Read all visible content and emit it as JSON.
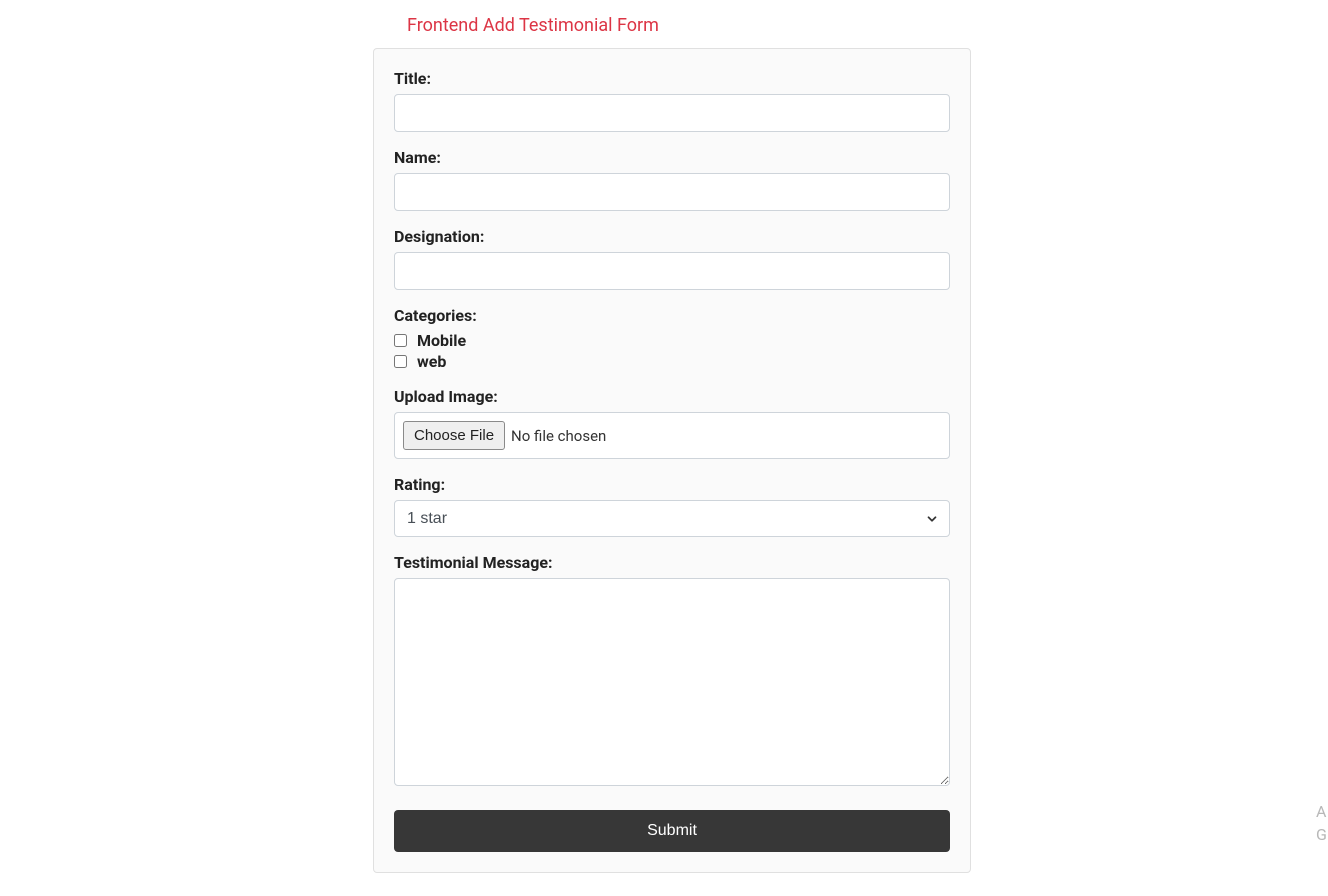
{
  "pageTitle": "Frontend Add Testimonial Form",
  "form": {
    "titleLabel": "Title:",
    "titleValue": "",
    "nameLabel": "Name:",
    "nameValue": "",
    "designationLabel": "Designation:",
    "designationValue": "",
    "categoriesLabel": "Categories:",
    "categories": [
      {
        "label": "Mobile",
        "checked": false
      },
      {
        "label": "web",
        "checked": false
      }
    ],
    "uploadLabel": "Upload Image:",
    "chooseFileLabel": "Choose File",
    "noFileText": "No file chosen",
    "ratingLabel": "Rating:",
    "ratingValue": "1 star",
    "messageLabel": "Testimonial Message:",
    "messageValue": "",
    "submitLabel": "Submit"
  },
  "watermark": {
    "line1": "A",
    "line2": "G"
  }
}
